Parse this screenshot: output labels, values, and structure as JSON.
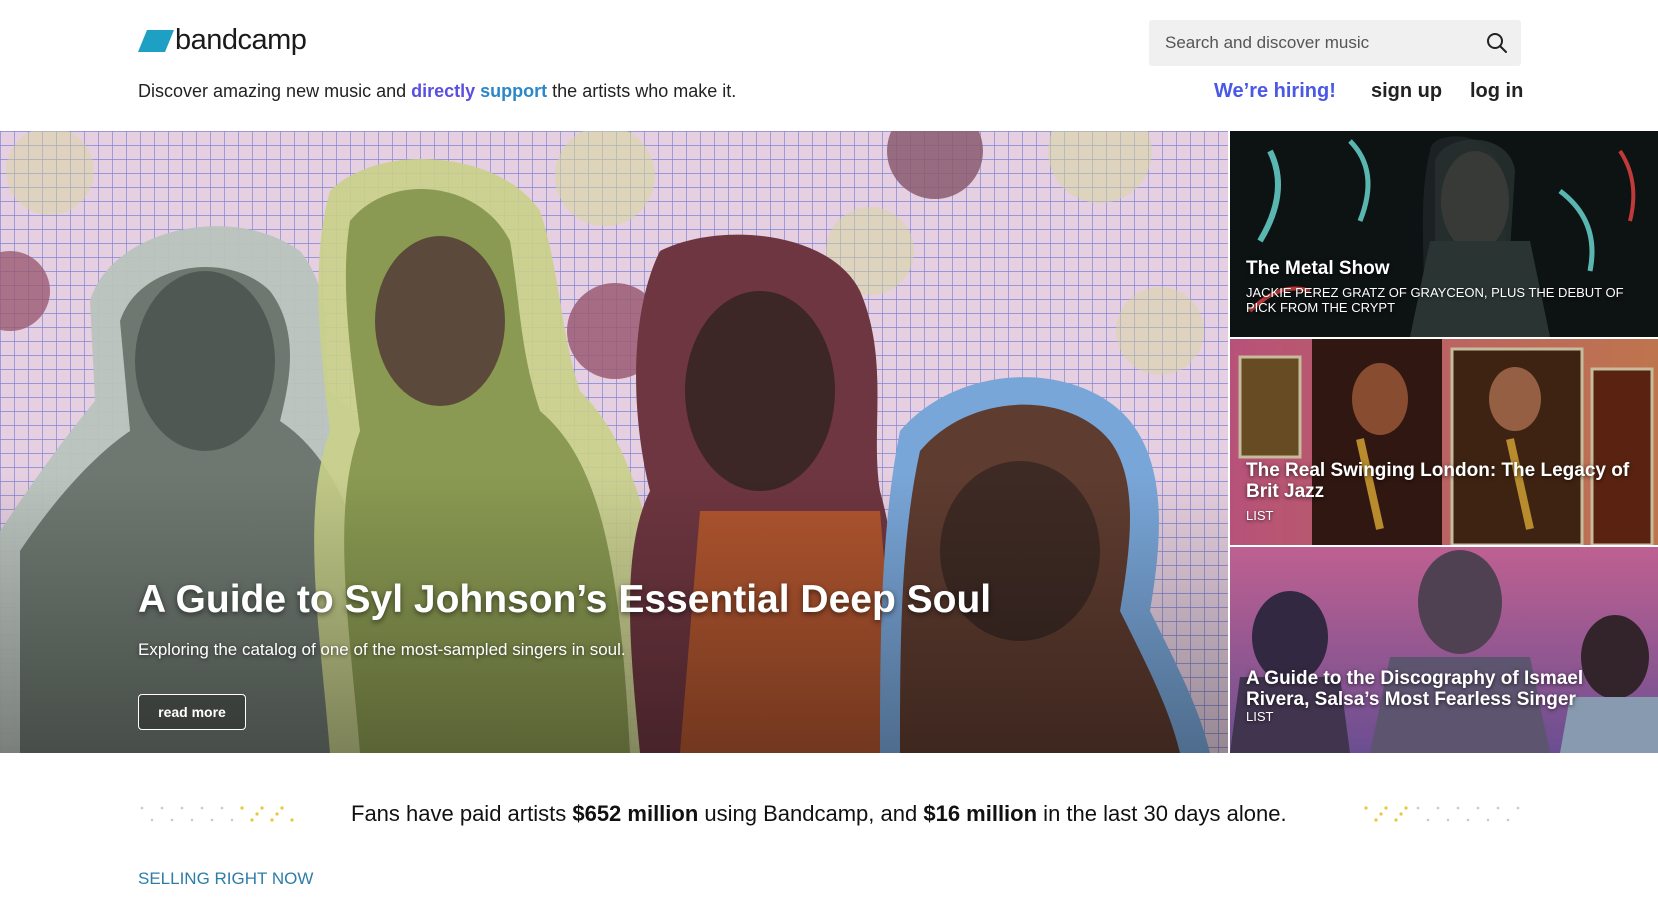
{
  "header": {
    "logo_text": "bandcamp",
    "tagline": {
      "part1": "Discover amazing new music and ",
      "highlight1": "directly",
      "space": " ",
      "highlight2": "support",
      "part2": " the artists who make it."
    },
    "search_placeholder": "Search and discover music",
    "nav": {
      "hiring": "We’re hiring!",
      "signup": "sign up",
      "login": "log in"
    }
  },
  "hero": {
    "title": "A Guide to Syl Johnson’s Essential Deep Soul",
    "subtitle": "Exploring the catalog of one of the most-sampled singers in soul.",
    "button": "read more"
  },
  "side_stories": [
    {
      "title": "The Metal Show",
      "meta": "Jackie Perez Gratz of Grayceon, plus the debut of Pick From the Crypt"
    },
    {
      "title": "The Real Swinging London: The Legacy of Brit Jazz",
      "meta": "List"
    },
    {
      "title": "A Guide to the Discography of Ismael Rivera, Salsa’s Most Fearless Singer",
      "meta": "List"
    }
  ],
  "stats": {
    "part1": "Fans have paid artists ",
    "amount_total": "$652 million",
    "part2": " using Bandcamp, and ",
    "amount_recent": "$16 million",
    "part3": " in the last 30 days alone."
  },
  "section_label": "SELLING RIGHT NOW",
  "colors": {
    "brand": "#1da0c3",
    "hiring": "#4a58e6",
    "directly": "#5a4fe0",
    "support": "#2b87c8",
    "section_label": "#2e7da8"
  }
}
